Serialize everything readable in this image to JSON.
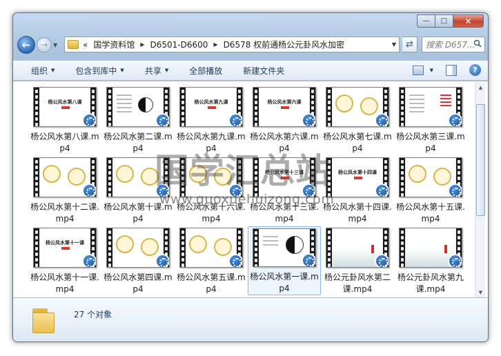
{
  "window": {
    "caption": {
      "minimize": "—",
      "maximize": "□",
      "close": "✕"
    }
  },
  "nav": {
    "back_icon": "arrow-left-icon",
    "forward_icon": "arrow-right-icon",
    "breadcrumb_prefix": "«",
    "breadcrumbs": [
      "国学资料馆",
      "D6501-D6600",
      "D6578 权前通杨公元卦风水加密"
    ],
    "search_placeholder": "搜索 D657..."
  },
  "toolbar": {
    "organize": "组织",
    "include_in_library": "包含到库中",
    "share": "共享",
    "play_all": "全部播放",
    "new_folder": "新建文件夹"
  },
  "files": [
    {
      "name": "杨公风水第八课.mp4",
      "thumb": "title",
      "thumb_text": "杨公风水第八课"
    },
    {
      "name": "杨公风水第二课.mp4",
      "thumb": "table-yy"
    },
    {
      "name": "杨公风水第九课.mp4",
      "thumb": "title",
      "thumb_text": "杨公风水第九课"
    },
    {
      "name": "杨公风水第六课.mp4",
      "thumb": "title",
      "thumb_text": "杨公风水第六课"
    },
    {
      "name": "杨公风水第七课.mp4",
      "thumb": "circles"
    },
    {
      "name": "杨公风水第三课.mp4",
      "thumb": "chart"
    },
    {
      "name": "杨公风水第十二课.mp4",
      "thumb": "circles"
    },
    {
      "name": "杨公风水第十课.mp4",
      "thumb": "circles"
    },
    {
      "name": "杨公风水第十六课.mp4",
      "thumb": "circles"
    },
    {
      "name": "杨公风水第十三课.mp4",
      "thumb": "title",
      "thumb_text": "杨公风水第十三课"
    },
    {
      "name": "杨公风水第十四课.mp4",
      "thumb": "title",
      "thumb_text": "杨公风水第十四课"
    },
    {
      "name": "杨公风水第十五课.mp4",
      "thumb": "circles"
    },
    {
      "name": "杨公风水第十一课.mp4",
      "thumb": "title",
      "thumb_text": "杨公风水第十一课"
    },
    {
      "name": "杨公风水第四课.mp4",
      "thumb": "circles"
    },
    {
      "name": "杨公风水第五课.mp4",
      "thumb": "circles"
    },
    {
      "name": "杨公风水第一课.mp4",
      "thumb": "yinyang",
      "selected": true
    },
    {
      "name": "杨公元卦风水第二课.mp4",
      "thumb": "ink"
    },
    {
      "name": "杨公元卦风水第九课.mp4",
      "thumb": "ink"
    }
  ],
  "watermark": {
    "title": "国学汇总站",
    "url": "www.guoxuehuizong.com"
  },
  "details": {
    "item_count": "27 个对象"
  },
  "colors": {
    "accent": "#1f5fa8",
    "toolbar_text": "#1e395b",
    "selection": "#8bb8e2"
  }
}
